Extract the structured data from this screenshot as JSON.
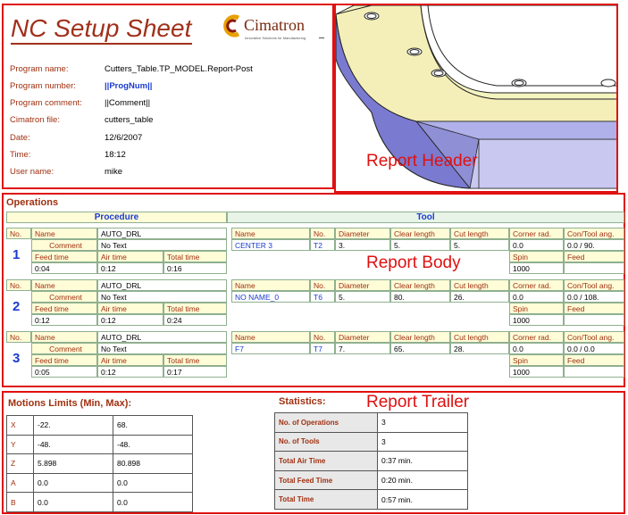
{
  "header": {
    "title": "NC Setup Sheet",
    "logo": {
      "name": "Cimatron",
      "tagline": "Innovative Solutions for Manufacturing"
    },
    "fields": [
      {
        "label": "Program name:",
        "value": "Cutters_Table.TP_MODEL.Report-Post"
      },
      {
        "label": "Program number:",
        "value": "||ProgNum||"
      },
      {
        "label": "Program comment:",
        "value": "||Comment||"
      },
      {
        "label": "Cimatron file:",
        "value": "cutters_table"
      },
      {
        "label": "Date:",
        "value": "12/6/2007"
      },
      {
        "label": "Time:",
        "value": "18:12"
      },
      {
        "label": "User name:",
        "value": "mike"
      }
    ]
  },
  "labels": {
    "report_header": "Report Header",
    "report_body": "Report Body",
    "report_trailer": "Report Trailer"
  },
  "operations": {
    "title": "Operations",
    "procedure_header": "Procedure",
    "tool_header": "Tool",
    "col_labels": {
      "no": "No.",
      "name": "Name",
      "comment": "Comment",
      "feed_time": "Feed time",
      "air_time": "Air time",
      "total_time": "Total time",
      "tool_name": "Name",
      "tool_no": "No.",
      "diameter": "Diameter",
      "clear_length": "Clear length",
      "cut_length": "Cut length",
      "corner_rad": "Corner rad.",
      "con_tool_ang": "Con/Tool ang.",
      "spin": "Spin",
      "feed": "Feed"
    },
    "rows": [
      {
        "no": "1",
        "name": "AUTO_DRL",
        "comment": "No Text",
        "feed_time": "0:04",
        "air_time": "0:12",
        "total_time": "0:16",
        "tool_name": "CENTER 3",
        "tool_no": "T2",
        "diameter": "3.",
        "clear_length": "5.",
        "cut_length": "5.",
        "corner_rad": "0.0",
        "con_tool_ang": "0.0 / 90.",
        "spin": "1000",
        "feed": ""
      },
      {
        "no": "2",
        "name": "AUTO_DRL",
        "comment": "No Text",
        "feed_time": "0:12",
        "air_time": "0:12",
        "total_time": "0:24",
        "tool_name": "NO NAME_0",
        "tool_no": "T6",
        "diameter": "5.",
        "clear_length": "80.",
        "cut_length": "26.",
        "corner_rad": "0.0",
        "con_tool_ang": "0.0 / 108.",
        "spin": "1000",
        "feed": ""
      },
      {
        "no": "3",
        "name": "AUTO_DRL",
        "comment": "No Text",
        "feed_time": "0:05",
        "air_time": "0:12",
        "total_time": "0:17",
        "tool_name": "F7",
        "tool_no": "T7",
        "diameter": "7.",
        "clear_length": "65.",
        "cut_length": "28.",
        "corner_rad": "0.0",
        "con_tool_ang": "0.0 / 0.0",
        "spin": "1000",
        "feed": ""
      }
    ]
  },
  "motion_limits": {
    "title": "Motions Limits (Min, Max):",
    "rows": [
      {
        "axis": "X",
        "min": "-22.",
        "max": "68."
      },
      {
        "axis": "Y",
        "min": "-48.",
        "max": "-48."
      },
      {
        "axis": "Z",
        "min": "5.898",
        "max": "80.898"
      },
      {
        "axis": "A",
        "min": "0.0",
        "max": "0.0"
      },
      {
        "axis": "B",
        "min": "0.0",
        "max": "0.0"
      }
    ]
  },
  "statistics": {
    "title": "Statistics:",
    "rows": [
      {
        "label": "No. of Operations",
        "value": "3"
      },
      {
        "label": "No. of Tools",
        "value": "3"
      },
      {
        "label": "Total Air Time",
        "value": "0:37 min."
      },
      {
        "label": "Total Feed Time",
        "value": "0:20 min."
      },
      {
        "label": "Total Time",
        "value": "0:57 min."
      }
    ]
  },
  "colors": {
    "border_red": "#e01010",
    "label_brown": "#a03010",
    "accent_blue": "#1a3bd0",
    "header_cell_bg": "#fffcd8"
  }
}
